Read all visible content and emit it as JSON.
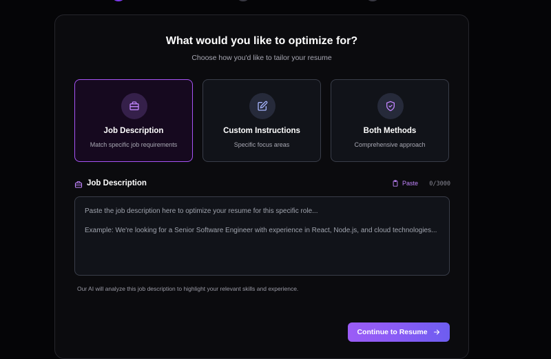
{
  "header": {
    "title": "What would you like to optimize for?",
    "subtitle": "Choose how you'd like to tailor your resume"
  },
  "options": [
    {
      "title": "Job Description",
      "description": "Match specific job requirements",
      "icon": "briefcase-icon",
      "selected": true
    },
    {
      "title": "Custom Instructions",
      "description": "Specific focus areas",
      "icon": "edit-icon",
      "selected": false
    },
    {
      "title": "Both Methods",
      "description": "Comprehensive approach",
      "icon": "shield-check-icon",
      "selected": false
    }
  ],
  "job_description": {
    "label": "Job Description",
    "paste_label": "Paste",
    "char_count": "0/3000",
    "placeholder_line1": "Paste the job description here to optimize your resume for this specific role...",
    "placeholder_line2": "Example: We're looking for a Senior Software Engineer with experience in React, Node.js, and cloud technologies...",
    "helper_text": "Our AI will analyze this job description to highlight your relevant skills and experience."
  },
  "actions": {
    "continue_label": "Continue to Resume"
  },
  "colors": {
    "accent": "#a855f7",
    "accent_text": "#c084fc",
    "background": "#050507",
    "card_bg": "#111319"
  }
}
